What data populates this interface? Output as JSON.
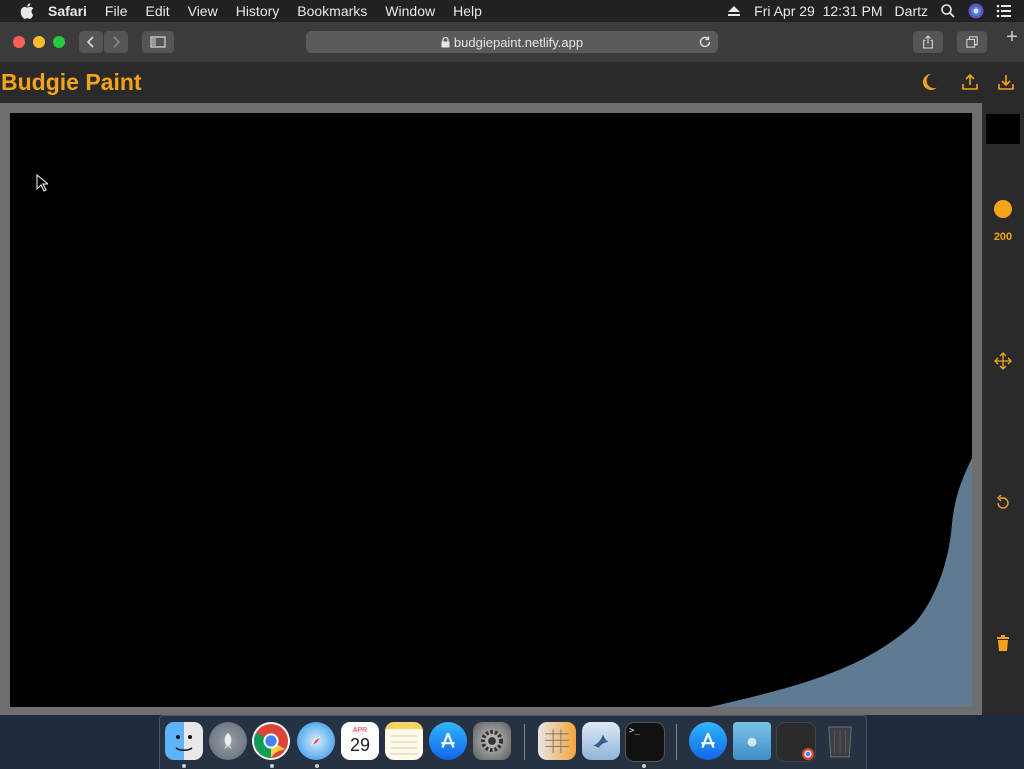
{
  "menubar": {
    "app_name": "Safari",
    "items": [
      "File",
      "Edit",
      "View",
      "History",
      "Bookmarks",
      "Window",
      "Help"
    ],
    "datetime": "Fri Apr 29  12:31 PM",
    "user": "Dartz"
  },
  "browser": {
    "url": "budgiepaint.netlify.app"
  },
  "app": {
    "title": "Budgie Paint",
    "accent_color": "#f5a418",
    "brush_size": "200",
    "current_color": "#000000"
  },
  "dock": {
    "calendar_month": "APR",
    "calendar_day": "29",
    "items": [
      "Finder",
      "Launchpad",
      "Google Chrome",
      "Safari",
      "Calendar",
      "Notes",
      "App Store",
      "System Preferences",
      "Numbers",
      "Preview",
      "Terminal",
      "App Store",
      "Downloads",
      "Chrome Window",
      "Trash"
    ]
  }
}
